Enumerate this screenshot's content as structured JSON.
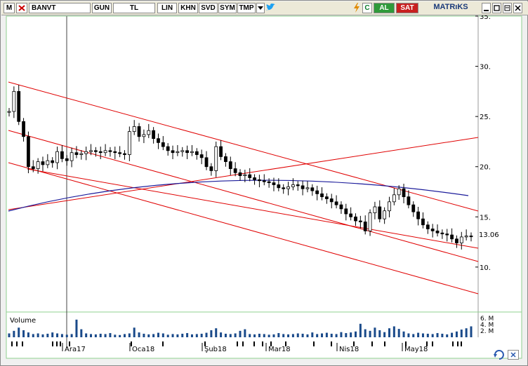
{
  "toolbar": {
    "menu_letter": "M",
    "symbol": "BANVT",
    "period": "GUN",
    "currency": "TL",
    "scale": "LIN",
    "buttons": [
      "KHN",
      "SVD",
      "SYM",
      "TMP"
    ],
    "refresh_letter": "C",
    "buy_label": "AL",
    "sell_label": "SAT",
    "brand": "MATRıKS"
  },
  "colors": {
    "candle": "#000000",
    "channel_lines": "#e00000",
    "moving_average": "#1a1a9a",
    "volume_bars": "#1a4a8a",
    "buy_bg": "#2f9a3a",
    "sell_bg": "#c82020",
    "panel_border": "#8fd08f"
  },
  "chart_data": {
    "type": "candlestick",
    "symbol": "BANVT",
    "last_price": 13.06,
    "last_price_label": "13.06",
    "y_ticks": [
      "35.",
      "30.",
      "25.",
      "20.",
      "15.",
      "10."
    ],
    "y_tick_values": [
      35,
      30,
      25,
      20,
      15,
      10
    ],
    "ylim": [
      5.8,
      35
    ],
    "x_ticks": [
      "Ara17",
      "Oca18",
      "Şub18",
      "Mar18",
      "Nis18",
      "May18"
    ],
    "volume_label": "Volume",
    "volume_ticks": [
      "6. M",
      "4. M",
      "2. M"
    ],
    "volume_ylim": [
      0,
      7
    ],
    "closes": [
      25.5,
      27.5,
      24.5,
      23.0,
      20.0,
      19.8,
      20.5,
      20.2,
      20.6,
      20.4,
      21.5,
      20.8,
      20.6,
      21.4,
      21.2,
      21.3,
      21.5,
      21.6,
      21.5,
      21.4,
      21.6,
      21.5,
      21.4,
      21.3,
      21.2,
      23.5,
      24.0,
      23.0,
      23.2,
      23.6,
      22.8,
      22.4,
      22.0,
      21.6,
      21.4,
      21.5,
      21.6,
      21.4,
      21.5,
      21.2,
      20.9,
      20.0,
      19.6,
      22.0,
      21.0,
      20.5,
      19.8,
      19.4,
      19.1,
      19.2,
      18.9,
      18.7,
      18.6,
      18.5,
      18.4,
      18.2,
      17.9,
      17.8,
      18.0,
      18.2,
      18.1,
      17.8,
      17.9,
      17.6,
      17.3,
      17.0,
      16.8,
      16.5,
      16.2,
      15.8,
      15.3,
      15.0,
      14.6,
      14.5,
      13.6,
      15.4,
      16.0,
      14.8,
      15.6,
      16.5,
      17.2,
      17.8,
      17.0,
      16.2,
      15.5,
      14.8,
      14.2,
      13.8,
      13.6,
      13.4,
      13.3,
      13.2,
      12.8,
      12.4,
      13.0,
      13.1,
      13.06
    ],
    "volumes": [
      1.2,
      2.0,
      3.0,
      2.2,
      1.5,
      1.0,
      1.2,
      0.9,
      1.1,
      1.5,
      1.2,
      1.0,
      0.8,
      1.0,
      5.5,
      2.5,
      1.2,
      1.0,
      0.9,
      1.1,
      1.0,
      1.3,
      0.8,
      0.7,
      1.0,
      1.2,
      3.0,
      1.5,
      1.1,
      0.9,
      1.0,
      1.4,
      1.2,
      0.8,
      1.0,
      0.9,
      1.1,
      1.3,
      0.9,
      1.0,
      1.1,
      1.4,
      2.2,
      2.8,
      1.5,
      1.1,
      1.0,
      1.2,
      2.0,
      2.5,
      1.0,
      0.9,
      1.1,
      1.0,
      0.8,
      0.9,
      1.3,
      1.0,
      0.9,
      1.0,
      1.2,
      1.1,
      0.9,
      1.5,
      1.0,
      1.2,
      1.4,
      1.1,
      1.0,
      1.6,
      1.3,
      1.5,
      1.8,
      4.2,
      2.5,
      2.0,
      3.0,
      2.2,
      1.6,
      2.8,
      3.4,
      2.6,
      1.8,
      1.2,
      1.0,
      1.4,
      1.2,
      1.1,
      1.0,
      1.3,
      1.1,
      0.9,
      1.4,
      1.8,
      2.4,
      2.8,
      3.4
    ]
  }
}
